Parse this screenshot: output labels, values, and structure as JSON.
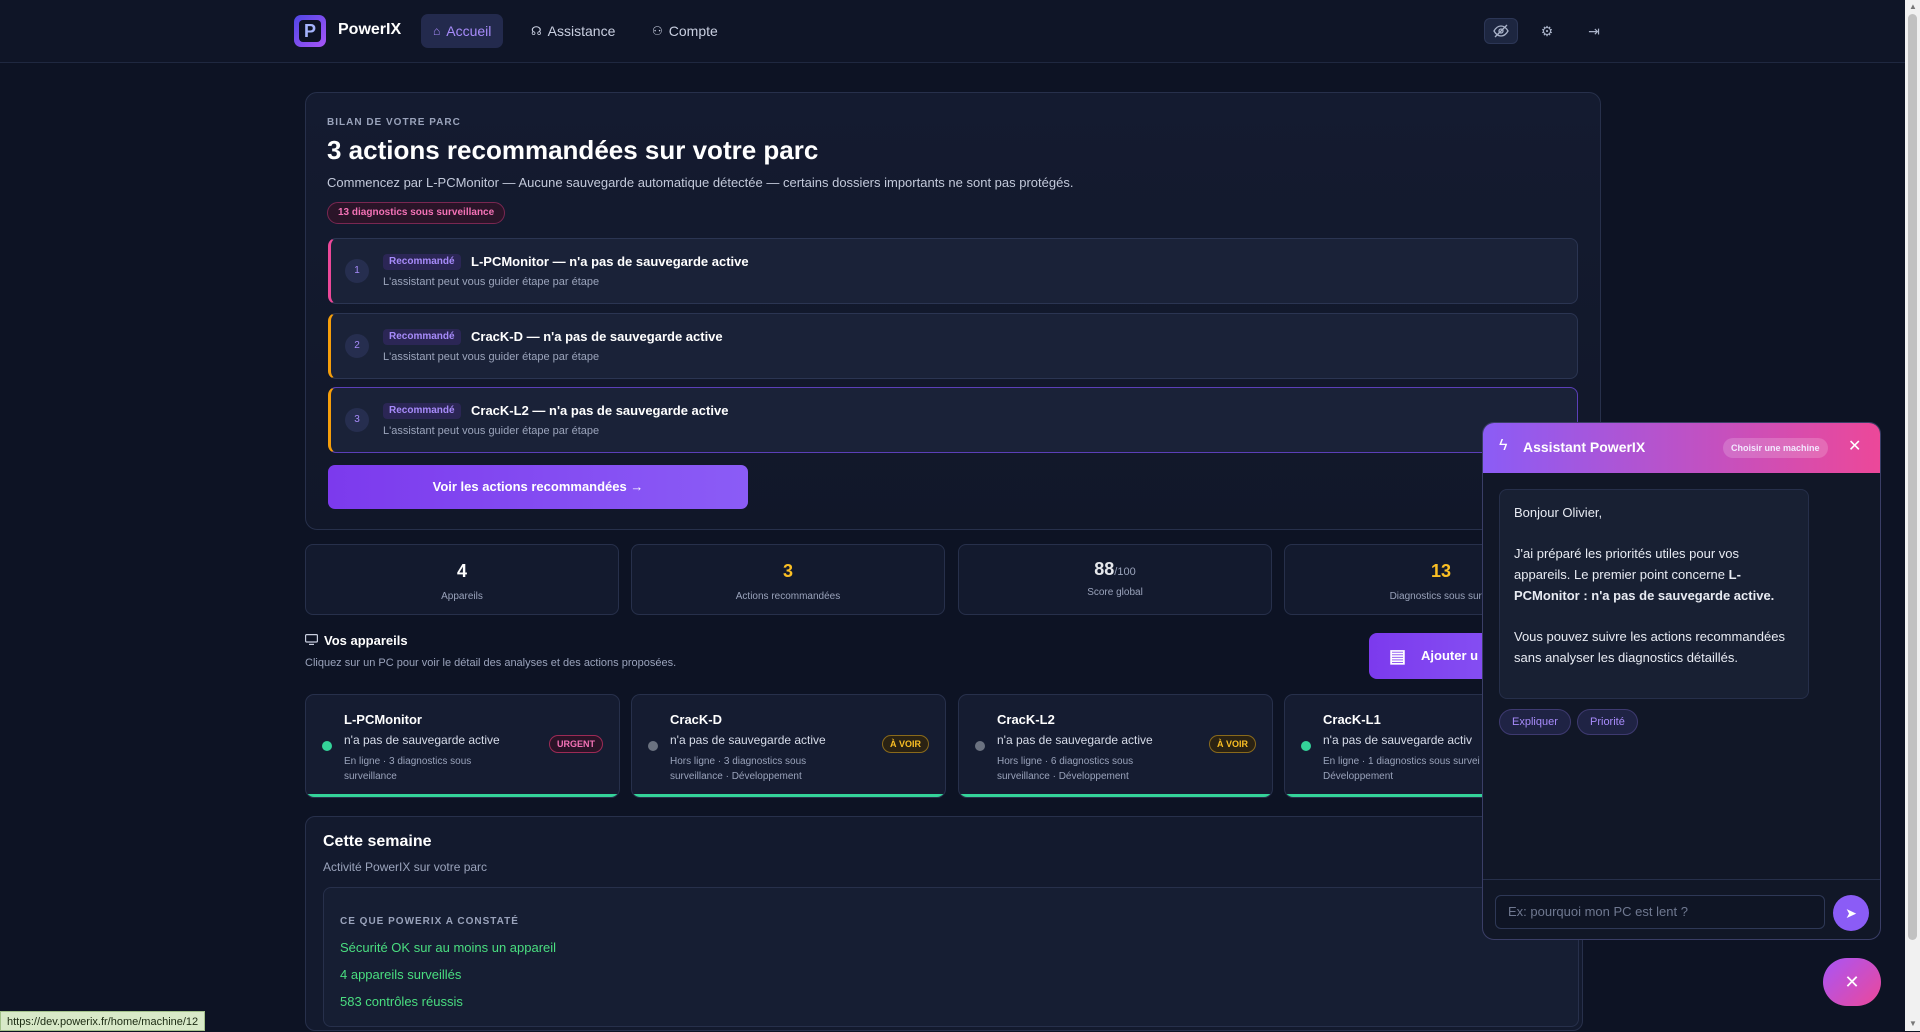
{
  "header": {
    "brand": "PowerIX",
    "logo_letter": "P",
    "nav": [
      {
        "label": "Accueil",
        "icon": "home-icon",
        "active": true
      },
      {
        "label": "Assistance",
        "icon": "headset-icon"
      },
      {
        "label": "Compte",
        "icon": "user-icon"
      }
    ],
    "icons": [
      "eye-off-icon",
      "gear-icon",
      "logout-icon"
    ]
  },
  "hero": {
    "eyebrow": "BILAN DE VOTRE PARC",
    "title": "3 actions recommandées sur votre parc",
    "subtitle": "Commencez par L-PCMonitor — Aucune sauvegarde automatique détectée — certains dossiers importants ne sont pas protégés.",
    "pill": "13 diagnostics sous surveillance",
    "recommendations": [
      {
        "num": "1",
        "tag": "Recommandé",
        "title": "L-PCMonitor — n'a pas de sauvegarde active",
        "desc": "L'assistant peut vous guider étape par étape",
        "accent": "#ec4899"
      },
      {
        "num": "2",
        "tag": "Recommandé",
        "title": "CracK-D — n'a pas de sauvegarde active",
        "desc": "L'assistant peut vous guider étape par étape",
        "accent": "#f59e0b"
      },
      {
        "num": "3",
        "tag": "Recommandé",
        "title": "CracK-L2 — n'a pas de sauvegarde active",
        "desc": "L'assistant peut vous guider étape par étape",
        "accent": "#f59e0b"
      }
    ],
    "cta": "Voir les actions recommandées →"
  },
  "stats": [
    {
      "value": "4",
      "unit": "",
      "label": "Appareils",
      "color": "#ffffff"
    },
    {
      "value": "3",
      "unit": "",
      "label": "Actions recommandées",
      "color": "#fbbf24"
    },
    {
      "value": "88",
      "unit": "/100",
      "label": "Score global",
      "color": "#e5e7eb"
    },
    {
      "value": "13",
      "unit": "",
      "label": "Diagnostics sous surve",
      "color": "#fbbf24"
    }
  ],
  "devices_section": {
    "title": "Vos appareils",
    "subtitle": "Cliquez sur un PC pour voir le détail des analyses et des actions proposées.",
    "add_button": "Ajouter u"
  },
  "devices": [
    {
      "name": "L-PCMonitor",
      "issue": "n'a pas de sauvegarde active",
      "meta": "En ligne · 3 diagnostics sous surveillance",
      "badge": "URGENT",
      "badge_type": "urgent",
      "dot": "#34d399"
    },
    {
      "name": "CracK-D",
      "issue": "n'a pas de sauvegarde active",
      "meta": "Hors ligne · 3 diagnostics sous surveillance · Développement",
      "badge": "À VOIR",
      "badge_type": "voir",
      "dot": "#6b7280"
    },
    {
      "name": "CracK-L2",
      "issue": "n'a pas de sauvegarde active",
      "meta": "Hors ligne · 6 diagnostics sous surveillance · Développement",
      "badge": "À VOIR",
      "badge_type": "voir",
      "dot": "#6b7280"
    },
    {
      "name": "CracK-L1",
      "issue": "n'a pas de sauvegarde activ",
      "meta": "En ligne · 1 diagnostics sous survei Développement",
      "badge": "",
      "badge_type": "",
      "dot": "#34d399"
    }
  ],
  "week": {
    "title": "Cette semaine",
    "subtitle": "Activité PowerIX sur votre parc",
    "eyebrow": "CE QUE POWERIX A CONSTATÉ",
    "items": [
      "Sécurité OK sur au moins un appareil",
      "4 appareils surveillés",
      "583 contrôles réussis"
    ]
  },
  "status_url": "https://dev.powerix.fr/home/machine/12",
  "chat": {
    "title": "Assistant PowerIX",
    "pick_machine": "Choisir une machine",
    "greeting": "Bonjour Olivier,",
    "para1_a": "J'ai préparé les priorités utiles pour vos appareils. Le premier point concerne ",
    "para1_b": "L-PCMonitor : n'a pas de sauvegarde active.",
    "para2": "Vous pouvez suivre les actions recommandées sans analyser les diagnostics détaillés.",
    "chips": [
      "Expliquer",
      "Priorité"
    ],
    "placeholder": "Ex: pourquoi mon PC est lent ?"
  }
}
